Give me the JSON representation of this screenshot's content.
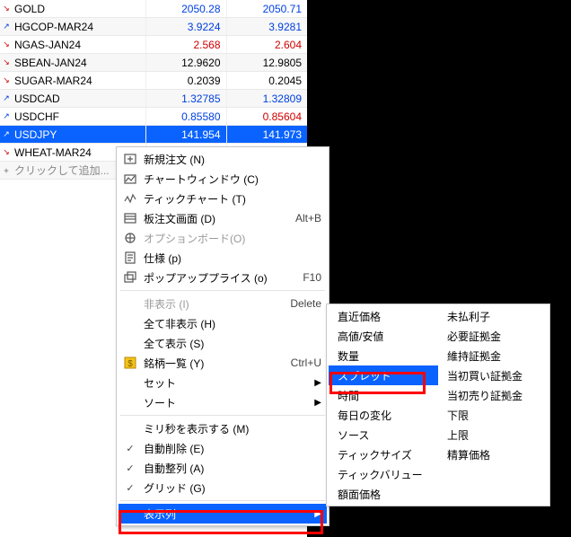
{
  "watch": {
    "rows": [
      {
        "arrow": "↘",
        "arrow_cls": "red",
        "symbol": "GOLD",
        "bid": "2050.28",
        "bid_cls": "blue",
        "ask": "2050.71",
        "ask_cls": "blue"
      },
      {
        "arrow": "↗",
        "arrow_cls": "blue",
        "symbol": "HGCOP-MAR24",
        "bid": "3.9224",
        "bid_cls": "blue",
        "ask": "3.9281",
        "ask_cls": "blue"
      },
      {
        "arrow": "↘",
        "arrow_cls": "red",
        "symbol": "NGAS-JAN24",
        "bid": "2.568",
        "bid_cls": "red",
        "ask": "2.604",
        "ask_cls": "red"
      },
      {
        "arrow": "↘",
        "arrow_cls": "red",
        "symbol": "SBEAN-JAN24",
        "bid": "12.9620",
        "bid_cls": "black",
        "ask": "12.9805",
        "ask_cls": "black"
      },
      {
        "arrow": "↘",
        "arrow_cls": "red",
        "symbol": "SUGAR-MAR24",
        "bid": "0.2039",
        "bid_cls": "black",
        "ask": "0.2045",
        "ask_cls": "black"
      },
      {
        "arrow": "↗",
        "arrow_cls": "blue",
        "symbol": "USDCAD",
        "bid": "1.32785",
        "bid_cls": "blue",
        "ask": "1.32809",
        "ask_cls": "blue"
      },
      {
        "arrow": "↗",
        "arrow_cls": "blue",
        "symbol": "USDCHF",
        "bid": "0.85580",
        "bid_cls": "blue",
        "ask": "0.85604",
        "ask_cls": "red"
      },
      {
        "arrow": "↗",
        "arrow_cls": "blue",
        "symbol": "USDJPY",
        "bid": "141.954",
        "bid_cls": "blue",
        "ask": "141.973",
        "ask_cls": "blue",
        "selected": true
      },
      {
        "arrow": "↘",
        "arrow_cls": "red",
        "symbol": "WHEAT-MAR24",
        "bid": "",
        "bid_cls": "",
        "ask": "",
        "ask_cls": ""
      }
    ],
    "add_hint": "クリックして追加..."
  },
  "ctx1": {
    "items": [
      {
        "icon": "new-order",
        "label": "新規注文 (N)",
        "shortcut": ""
      },
      {
        "icon": "chart-window",
        "label": "チャートウィンドウ (C)",
        "shortcut": ""
      },
      {
        "icon": "tick-chart",
        "label": "ティックチャート (T)",
        "shortcut": ""
      },
      {
        "icon": "depth",
        "label": "板注文画面 (D)",
        "shortcut": "Alt+B"
      },
      {
        "icon": "option-board",
        "label": "オプションボード(O)",
        "shortcut": "",
        "disabled": true
      },
      {
        "icon": "spec",
        "label": "仕様 (p)",
        "shortcut": ""
      },
      {
        "icon": "popup",
        "label": "ポップアッププライス (o)",
        "shortcut": "F10"
      },
      {
        "sep": true
      },
      {
        "icon": "",
        "label": "非表示 (I)",
        "shortcut": "Delete",
        "disabled": true
      },
      {
        "icon": "",
        "label": "全て非表示 (H)",
        "shortcut": ""
      },
      {
        "icon": "",
        "label": "全て表示 (S)",
        "shortcut": ""
      },
      {
        "icon": "sym-list",
        "label": "銘柄一覧 (Y)",
        "shortcut": "Ctrl+U"
      },
      {
        "icon": "",
        "label": "セット",
        "shortcut": "",
        "submenu": true
      },
      {
        "icon": "",
        "label": "ソート",
        "shortcut": "",
        "submenu": true
      },
      {
        "sep": true
      },
      {
        "icon": "",
        "label": "ミリ秒を表示する (M)",
        "shortcut": ""
      },
      {
        "icon": "check",
        "label": "自動削除 (E)",
        "shortcut": ""
      },
      {
        "icon": "check",
        "label": "自動整列 (A)",
        "shortcut": ""
      },
      {
        "icon": "check",
        "label": "グリッド (G)",
        "shortcut": ""
      },
      {
        "sep": true
      },
      {
        "icon": "",
        "label": "表示列",
        "shortcut": "",
        "submenu": true,
        "selected": true
      }
    ]
  },
  "ctx2": {
    "left": [
      "直近価格",
      "高値/安値",
      "数量",
      "スプレッド",
      "時間",
      "毎日の変化",
      "ソース",
      "ティックサイズ",
      "ティックバリュー",
      "額面価格"
    ],
    "right": [
      "未払利子",
      "必要証拠金",
      "維持証拠金",
      "当初買い証拠金",
      "当初売り証拠金",
      "下限",
      "上限",
      "精算価格"
    ],
    "selected": "スプレッド"
  }
}
